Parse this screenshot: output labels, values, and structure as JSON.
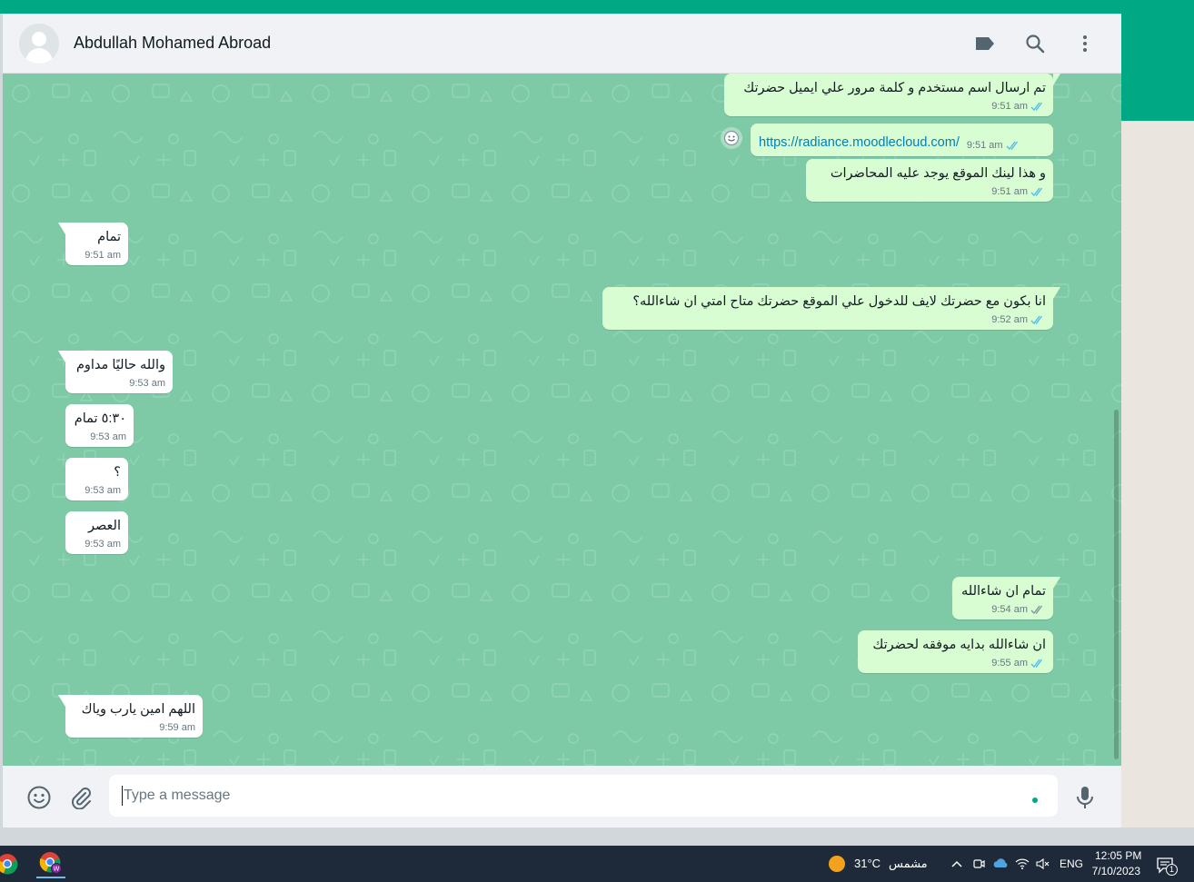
{
  "colors": {
    "brand_green": "#00a884",
    "chat_bg": "#7fcaa6",
    "outgoing_bubble": "#d9fdd3",
    "incoming_bubble": "#ffffff",
    "read_ticks": "#53bdeb",
    "taskbar": "#1e2a3a"
  },
  "header": {
    "contact_name": "Abdullah Mohamed Abroad",
    "icons": [
      "label-icon",
      "search-icon",
      "menu-icon"
    ]
  },
  "messages": [
    {
      "dir": "out",
      "text": "تم ارسال اسم مستخدم و كلمة مرور علي ايميل حضرتك",
      "time": "9:51 am",
      "status": "read"
    },
    {
      "dir": "out",
      "text": "https://radiance.moodlecloud.com/",
      "time": "9:51 am",
      "status": "read",
      "is_link": true
    },
    {
      "dir": "out",
      "text": "و هذا لينك الموقع يوجد عليه المحاضرات",
      "time": "9:51 am",
      "status": "read"
    },
    {
      "dir": "in",
      "text": "تمام",
      "time": "9:51 am"
    },
    {
      "dir": "out",
      "text": "انا بكون مع حضرتك لايف للدخول علي الموقع حضرتك متاح امتي ان شاءالله؟",
      "time": "9:52 am",
      "status": "read"
    },
    {
      "dir": "in",
      "text": "والله حاليًا مداوم",
      "time": "9:53 am"
    },
    {
      "dir": "in",
      "text": "٥:٣٠ تمام",
      "time": "9:53 am"
    },
    {
      "dir": "in",
      "text": "؟",
      "time": "9:53 am"
    },
    {
      "dir": "in",
      "text": "العصر",
      "time": "9:53 am"
    },
    {
      "dir": "out",
      "text": "تمام ان شاءالله",
      "time": "9:54 am",
      "status": "delivered"
    },
    {
      "dir": "out",
      "text": "ان شاءالله بدايه موفقه لحضرتك",
      "time": "9:55 am",
      "status": "read"
    },
    {
      "dir": "in",
      "text": "اللهم امين يارب وياك",
      "time": "9:59 am"
    }
  ],
  "composer": {
    "placeholder": "Type a message",
    "value": "",
    "icons": [
      "emoji-icon",
      "attach-icon",
      "mic-icon"
    ]
  },
  "taskbar": {
    "apps": [
      "chrome-icon",
      "chrome-profile-icon"
    ],
    "weather_temp": "31°C",
    "weather_desc": "مشمس",
    "language": "ENG",
    "time": "12:05 PM",
    "date": "7/10/2023",
    "notification_count": "1"
  }
}
